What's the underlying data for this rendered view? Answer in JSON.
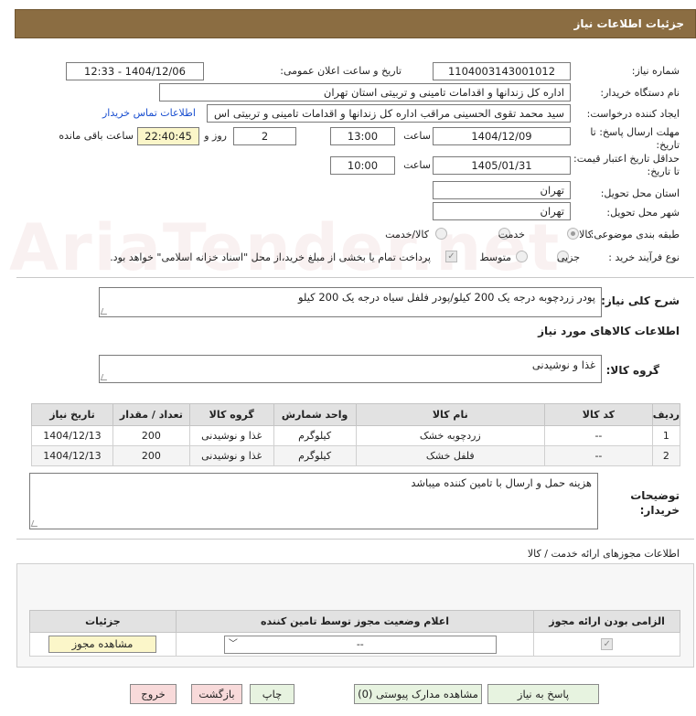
{
  "page": {
    "title": "جزئیات اطلاعات نیاز"
  },
  "watermark": "AriaTender.net",
  "fields": {
    "need_number_label": "شماره نیاز:",
    "need_number": "1104003143001012",
    "announce_label": "تاریخ و ساعت اعلان عمومی:",
    "announce_value": "1404/12/06 - 12:33",
    "buyer_org_label": "نام دستگاه خریدار:",
    "buyer_org": "اداره کل زندانها و اقدامات تامینی و تربیتی استان تهران",
    "requester_label": "ایجاد کننده درخواست:",
    "requester": "سید محمد تقوی الحسینی مراقب  اداره کل زندانها و اقدامات تامینی و تربیتی اس",
    "contact_link": "اطلاعات تماس خریدار",
    "reply_deadline_label": "مهلت ارسال پاسخ: تا تاریخ:",
    "reply_date": "1404/12/09",
    "time_label": "ساعت",
    "reply_time": "13:00",
    "days_value": "2",
    "days_label": "روز و",
    "remaining_time": "22:40:45",
    "remaining_label": "ساعت باقی مانده",
    "validity_label": "حداقل تاریخ اعتبار قیمت: تا تاریخ:",
    "validity_date": "1405/01/31",
    "validity_time": "10:00",
    "province_label": "استان محل تحویل:",
    "province": "تهران",
    "city_label": "شهر محل تحویل:",
    "city": "تهران",
    "category_label": "طبقه بندی موضوعی:",
    "category_options": [
      "کالا",
      "خدمت",
      "کالا/خدمت"
    ],
    "process_label": "نوع فرآیند خرید :",
    "process_options": [
      "جزیی",
      "متوسط"
    ],
    "payment_note": "پرداخت تمام یا بخشی از مبلغ خرید،از محل \"اسناد خزانه اسلامی\" خواهد بود."
  },
  "description": {
    "label": "شرح کلی نیاز:",
    "text": "پودر زردچوبه درجه یک 200 کیلو/پودر فلفل سیاه درجه یک 200 کیلو"
  },
  "goods_section": {
    "title": "اطلاعات کالاهای مورد نیاز",
    "group_label": "گروه کالا:",
    "group_value": "غذا و نوشیدنی"
  },
  "goods_table": {
    "headers": [
      "ردیف",
      "کد کالا",
      "نام کالا",
      "واحد شمارش",
      "گروه کالا",
      "تعداد / مقدار",
      "تاریخ نیاز"
    ],
    "rows": [
      [
        "1",
        "--",
        "زردچوبه خشک",
        "کیلوگرم",
        "غذا و نوشیدنی",
        "200",
        "1404/12/13"
      ],
      [
        "2",
        "--",
        "فلفل خشک",
        "کیلوگرم",
        "غذا و نوشیدنی",
        "200",
        "1404/12/13"
      ]
    ]
  },
  "buyer_notes": {
    "label": "توضیحات خریدار:",
    "text": "هزینه حمل و ارسال با تامین کننده میباشد"
  },
  "permits": {
    "title": "اطلاعات مجوزهای ارائه خدمت / کالا",
    "headers": [
      "الزامی بودن ارائه مجوز",
      "اعلام وضعیت مجوز توسط تامین کننده",
      "جزئیات"
    ],
    "select_value": "--",
    "view_button": "مشاهده مجوز"
  },
  "buttons": {
    "reply": "پاسخ به نیاز",
    "attachments": "مشاهده مدارک پیوستی (0)",
    "print": "چاپ",
    "back": "بازگشت",
    "exit": "خروج"
  }
}
